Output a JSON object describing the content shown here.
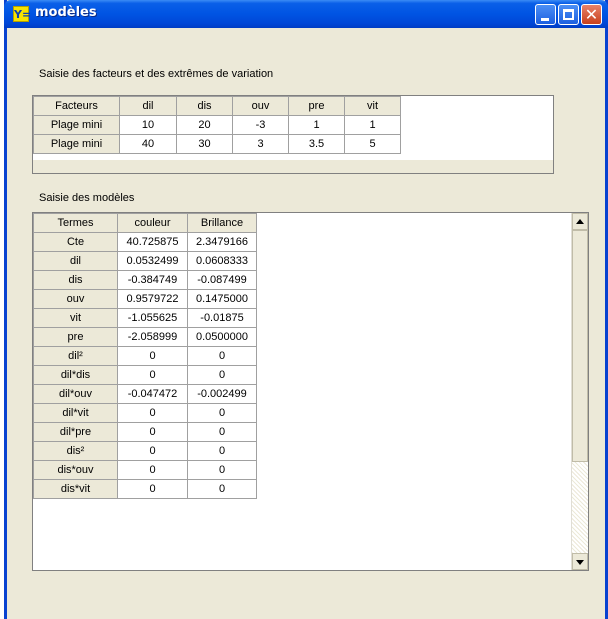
{
  "window": {
    "title": "modèles",
    "app_icon_text": "Y="
  },
  "section1": {
    "label": "Saisie des facteurs et des extrêmes de variation",
    "rows": [
      [
        "Facteurs",
        "dil",
        "dis",
        "ouv",
        "pre",
        "vit"
      ],
      [
        "Plage mini",
        "10",
        "20",
        "-3",
        "1",
        "1"
      ],
      [
        "Plage mini",
        "40",
        "30",
        "3",
        "3.5",
        "5"
      ]
    ]
  },
  "section2": {
    "label": "Saisie des modèles",
    "headers": [
      "Termes",
      "couleur",
      "Brillance"
    ],
    "rows": [
      [
        "Cte",
        "40.725875",
        "2.3479166"
      ],
      [
        "dil",
        "0.0532499",
        "0.0608333"
      ],
      [
        "dis",
        "-0.384749",
        "-0.087499"
      ],
      [
        "ouv",
        "0.9579722",
        "0.1475000"
      ],
      [
        "vit",
        "-1.055625",
        "-0.01875"
      ],
      [
        "pre",
        "-2.058999",
        "0.0500000"
      ],
      [
        "dil²",
        "0",
        "0"
      ],
      [
        "dil*dis",
        "0",
        "0"
      ],
      [
        "dil*ouv",
        "-0.047472",
        "-0.002499"
      ],
      [
        "dil*vit",
        "0",
        "0"
      ],
      [
        "dil*pre",
        "0",
        "0"
      ],
      [
        "dis²",
        "0",
        "0"
      ],
      [
        "dis*ouv",
        "0",
        "0"
      ],
      [
        "dis*vit",
        "0",
        "0"
      ]
    ]
  }
}
